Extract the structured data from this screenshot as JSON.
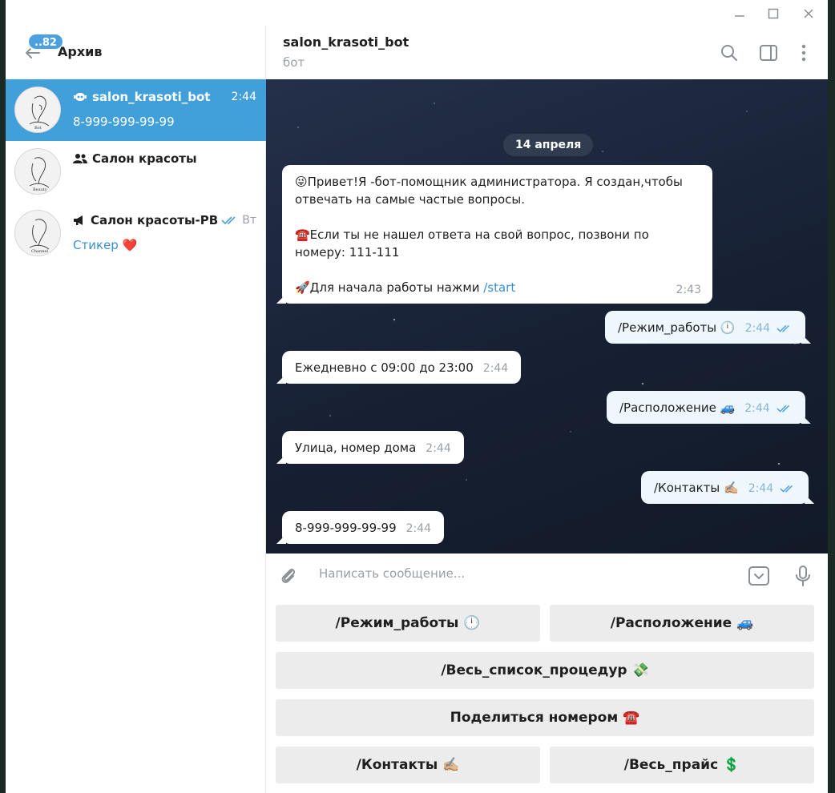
{
  "window": {
    "minimize": "—",
    "maximize": "☐",
    "close": "✕"
  },
  "sidebar": {
    "badge": "..82",
    "title": "Архив",
    "chats": [
      {
        "name": "salon_krasoti_bot",
        "time": "2:44",
        "sub": "8-999-999-99-99",
        "type": "bot"
      },
      {
        "name": "Салон красоты",
        "time": "",
        "sub": "",
        "type": "group"
      },
      {
        "name": "Салон красоты-РВ",
        "time": "Вт",
        "sub": "Стикер ❤️",
        "type": "channel"
      }
    ]
  },
  "chat": {
    "title": "salon_krasoti_bot",
    "subtitle": "бот",
    "date": "14 апреля",
    "messages": [
      {
        "dir": "in",
        "lines": [
          "😜Привет!Я -бот-помощник администратора. Я создан,чтобы",
          "отвечать на самые частые вопросы.",
          "",
          "☎️Если ты не нашел ответа на свой вопрос, позвони по",
          "номеру: 111-111",
          "",
          "🚀Для начала работы нажми"
        ],
        "link": "/start",
        "time": "2:43"
      },
      {
        "dir": "out",
        "text": "/Режим_работы 🕛",
        "time": "2:44"
      },
      {
        "dir": "in",
        "text": "Ежедневно с 09:00 до 23:00",
        "time": "2:44"
      },
      {
        "dir": "out",
        "text": "/Расположение 🚙",
        "time": "2:44"
      },
      {
        "dir": "in",
        "text": "Улица, номер дома",
        "time": "2:44"
      },
      {
        "dir": "out",
        "text": "/Контакты ✍🏼",
        "time": "2:44"
      },
      {
        "dir": "in",
        "text": "8-999-999-99-99",
        "time": "2:44"
      }
    ]
  },
  "compose": {
    "placeholder": "Написать сообщение..."
  },
  "keyboard": {
    "row1": [
      "/Режим_работы 🕛",
      "/Расположение 🚙"
    ],
    "row2": [
      "/Весь_список_процедур 💸"
    ],
    "row3": [
      "Поделиться номером ☎️"
    ],
    "row4": [
      "/Контакты ✍🏼",
      "/Весь_прайс 💲"
    ]
  },
  "colors": {
    "accent": "#419fd9",
    "link": "#3a8fd6",
    "out_bubble": "#eef7fe",
    "chat_bg": "#1a2230"
  },
  "icons": [
    "back-arrow-icon",
    "bot-icon",
    "group-icon",
    "channel-icon",
    "double-check-icon",
    "search-icon",
    "sidebar-toggle-icon",
    "more-vertical-icon",
    "attach-icon",
    "emoji-keyboard-icon",
    "microphone-icon"
  ]
}
